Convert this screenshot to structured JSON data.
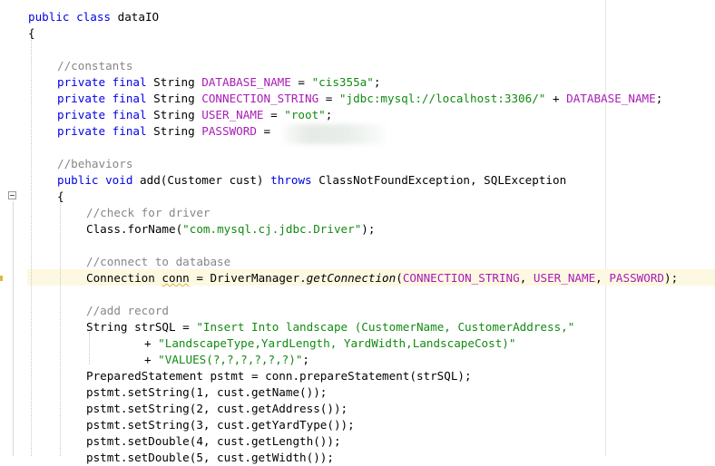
{
  "lines": {
    "l1": {
      "kw1": "public",
      "kw2": "class",
      "name": "dataIO"
    },
    "l2": {
      "brace": "{"
    },
    "l4": {
      "comment": "//constants"
    },
    "l5": {
      "kw": "private final",
      "type": "String",
      "field": "DATABASE_NAME",
      "eq": " = ",
      "str": "\"cis355a\"",
      "end": ";"
    },
    "l6": {
      "kw": "private final",
      "type": "String",
      "field": "CONNECTION_STRING",
      "eq": " = ",
      "str": "\"jdbc:mysql://localhost:3306/\"",
      "plus": " + ",
      "field2": "DATABASE_NAME",
      "end": ";"
    },
    "l7": {
      "kw": "private final",
      "type": "String",
      "field": "USER_NAME",
      "eq": " = ",
      "str": "\"root\"",
      "end": ";"
    },
    "l8": {
      "kw": "private final",
      "type": "String",
      "field": "PASSWORD",
      "eq": " = "
    },
    "l10": {
      "comment": "//behaviors"
    },
    "l11": {
      "kw1": "public",
      "kw2": "void",
      "sig": "add(Customer cust)",
      "kw3": "throws",
      "rest": "ClassNotFoundException, SQLException"
    },
    "l12": {
      "brace": "{"
    },
    "l13": {
      "comment": "//check for driver"
    },
    "l14": {
      "pre": "Class.forName(",
      "str": "\"com.mysql.cj.jdbc.Driver\"",
      "post": ");"
    },
    "l16": {
      "comment": "//connect to database"
    },
    "l17": {
      "pre": "Connection ",
      "var": "conn",
      "mid": " = DriverManager.",
      "method": "getConnection",
      "open": "(",
      "f1": "CONNECTION_STRING",
      "c1": ", ",
      "f2": "USER_NAME",
      "c2": ", ",
      "f3": "PASSWORD",
      "post": ");"
    },
    "l19": {
      "comment": "//add record"
    },
    "l20": {
      "pre": "String strSQL = ",
      "str": "\"Insert Into landscape (CustomerName, CustomerAddress,\""
    },
    "l21": {
      "pre": "+ ",
      "str": "\"LandscapeType,YardLength, YardWidth,LandscapeCost)\""
    },
    "l22": {
      "pre": "+ ",
      "str": "\"VALUES(?,?,?,?,?,?)\"",
      "post": ";"
    },
    "l23": {
      "text": "PreparedStatement pstmt = conn.prepareStatement(strSQL);"
    },
    "l24": {
      "text": "pstmt.setString(1, cust.getName());"
    },
    "l25": {
      "text": "pstmt.setString(2, cust.getAddress());"
    },
    "l26": {
      "text": "pstmt.setString(3, cust.getYardType());"
    },
    "l27": {
      "text": "pstmt.setDouble(4, cust.getLength());"
    },
    "l28": {
      "text": "pstmt.setDouble(5, cust.getWidth());"
    }
  },
  "colors": {
    "keyword": "#0000e6",
    "field": "#a81db8",
    "string": "#128a12",
    "comment": "#878787",
    "current_line": "#fdf8e1"
  },
  "icons": {
    "fold": "fold-collapse-icon",
    "warning": "warning-marker-icon"
  }
}
